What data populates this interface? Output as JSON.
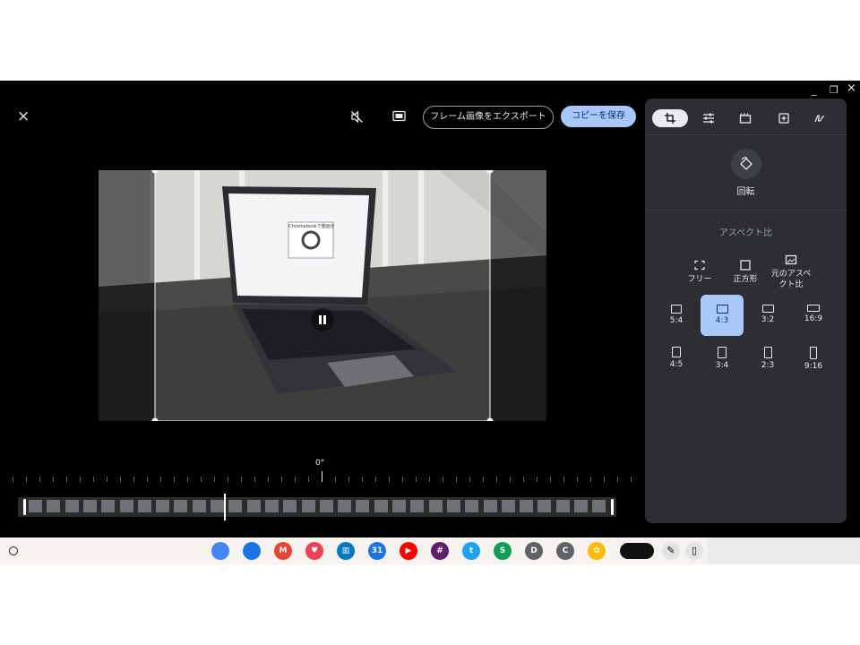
{
  "toolbar": {
    "export_label": "フレーム画像をエクスポート",
    "save_label": "コピーを保存",
    "close_icon": "×",
    "mute_icon": "volume-off-icon",
    "screenshot_icon": "picture-icon"
  },
  "window": {
    "minimize": "_",
    "restore": "❐",
    "close": "×"
  },
  "panel": {
    "rotate_label": "回転",
    "aspect_title": "アスペクト比",
    "options": [
      {
        "label": "フリー"
      },
      {
        "label": "正方形"
      },
      {
        "label": "元のアスペクト比"
      }
    ],
    "ratios": [
      "5:4",
      "4:3",
      "3:2",
      "16:9",
      "4:5",
      "3:4",
      "2:3",
      "9:16"
    ],
    "selected_ratio": "4:3"
  },
  "video": {
    "screen_title": "Chromebookで動画を",
    "angle": "0°"
  },
  "shelf": {
    "apps": [
      {
        "name": "chrome",
        "color": "#4285f4",
        "letter": ""
      },
      {
        "name": "files",
        "color": "#1a73e8",
        "letter": ""
      },
      {
        "name": "gmail",
        "color": "#ea4335",
        "letter": "M"
      },
      {
        "name": "pocket",
        "color": "#ef4056",
        "letter": "♥"
      },
      {
        "name": "trello",
        "color": "#0079bf",
        "letter": "▥"
      },
      {
        "name": "calendar",
        "color": "#1a73e8",
        "letter": "31"
      },
      {
        "name": "youtube",
        "color": "#ff0000",
        "letter": "▶"
      },
      {
        "name": "slack",
        "color": "#611f69",
        "letter": "#"
      },
      {
        "name": "twitter",
        "color": "#1da1f2",
        "letter": "t"
      },
      {
        "name": "sheet",
        "color": "#0f9d58",
        "letter": "S"
      },
      {
        "name": "d-app",
        "color": "#5f6368",
        "letter": "D"
      },
      {
        "name": "c-app",
        "color": "#5f6368",
        "letter": "C"
      },
      {
        "name": "photos",
        "color": "#fbbc04",
        "letter": "✿"
      }
    ]
  }
}
